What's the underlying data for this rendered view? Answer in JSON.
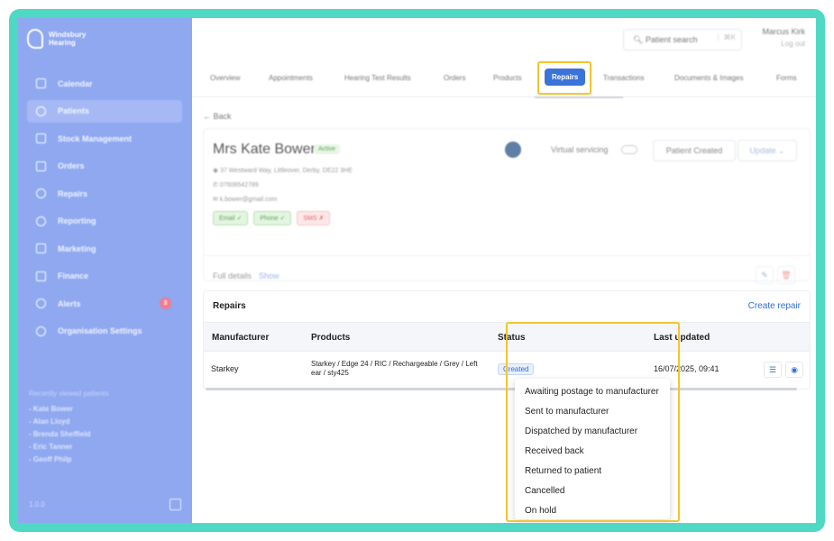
{
  "sidebar": {
    "brand": "Windsbury Hearing",
    "items": [
      {
        "label": "Calendar",
        "icon": "calendar-icon"
      },
      {
        "label": "Patients",
        "icon": "patients-icon",
        "active": true
      },
      {
        "label": "Stock Management",
        "icon": "stock-icon"
      },
      {
        "label": "Orders",
        "icon": "orders-icon"
      },
      {
        "label": "Repairs",
        "icon": "wrench-icon"
      },
      {
        "label": "Reporting",
        "icon": "chart-icon"
      },
      {
        "label": "Marketing",
        "icon": "mail-icon"
      },
      {
        "label": "Finance",
        "icon": "card-icon"
      },
      {
        "label": "Alerts",
        "icon": "bell-icon",
        "badge": "3"
      },
      {
        "label": "Organisation Settings",
        "icon": "gear-icon"
      }
    ],
    "recent_title": "Recently viewed patients",
    "recent": [
      "- Kate Bower",
      "- Alan Lloyd",
      "- Brenda Sheffield",
      "- Eric Tanner",
      "- Geoff Philp"
    ],
    "version": "1.0.0"
  },
  "topbar": {
    "search_placeholder": "Patient search",
    "search_shortcut": "⌘K",
    "user_name": "Marcus Kirk",
    "logout": "Log out"
  },
  "tabs": [
    "Overview",
    "Appointments",
    "Hearing Test Results",
    "Orders",
    "Products",
    "Repairs",
    "Transactions",
    "Documents & Images",
    "Forms"
  ],
  "back_label": "Back",
  "patient": {
    "name": "Mrs Kate Bower",
    "status": "Active",
    "address": "37 Westward Way, Littleover, Derby, DE22 3HE",
    "phone": "07606542789",
    "email": "k.bower@gmail.com",
    "contact_badges": [
      "Email ✓",
      "Phone ✓",
      "SMS ✗"
    ],
    "virtual_servicing": "Virtual servicing",
    "created_label": "Patient Created",
    "update_label": "Update",
    "full_details": "Full details",
    "show": "Show"
  },
  "repairs": {
    "title": "Repairs",
    "create_label": "Create repair",
    "columns": [
      "Manufacturer",
      "Products",
      "Status",
      "Last updated"
    ],
    "rows": [
      {
        "manufacturer": "Starkey",
        "products": "Starkey / Edge 24 / RIC / Rechargeable / Grey / Left ear / sty425",
        "status": "Created",
        "last_updated": "16/07/2025, 09:41"
      }
    ]
  },
  "status_options": [
    "Awaiting postage to manufacturer",
    "Sent to manufacturer",
    "Dispatched by manufacturer",
    "Received back",
    "Returned to patient",
    "Cancelled",
    "On hold"
  ],
  "colors": {
    "frame": "#4fd8c4",
    "sidebar": "#8fa8f0",
    "accent": "#2f6fd8",
    "highlight": "#f4c430"
  }
}
